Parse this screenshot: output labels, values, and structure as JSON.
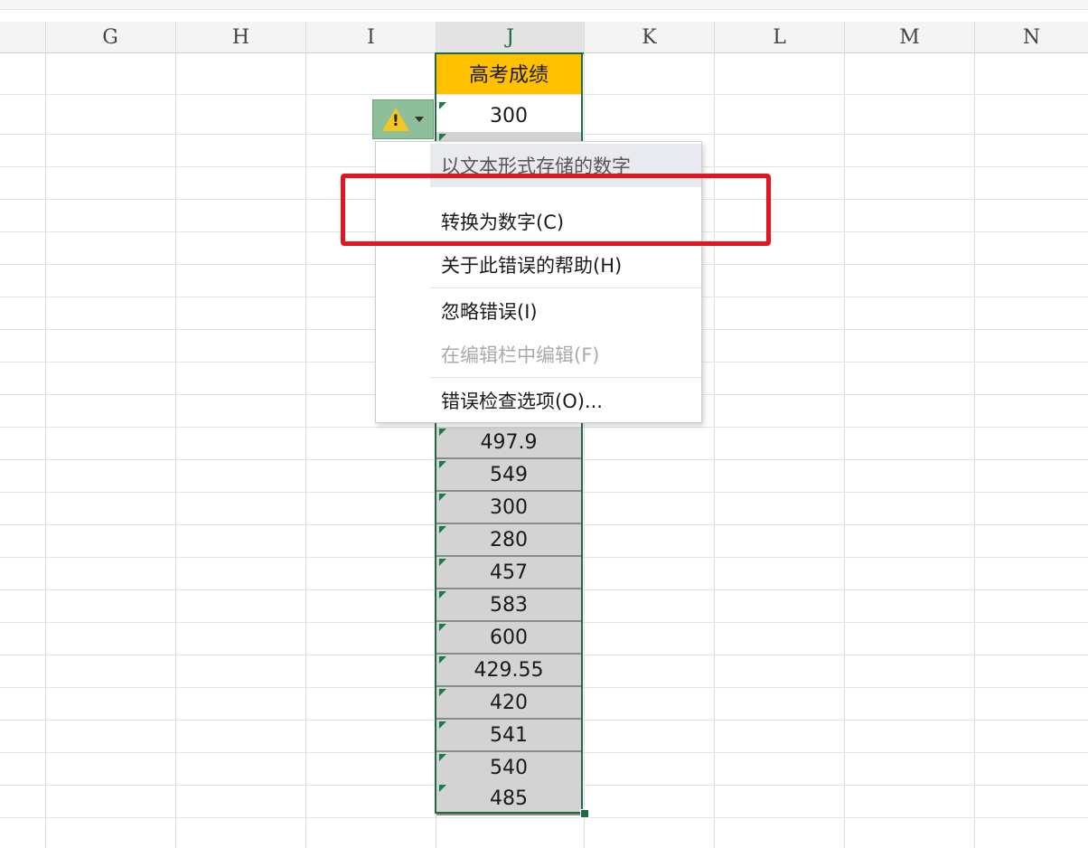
{
  "columns": [
    "G",
    "H",
    "I",
    "J",
    "K",
    "L",
    "M",
    "N"
  ],
  "active_column": "J",
  "header_cell": "高考成绩",
  "first_value": "300",
  "values": [
    "497.9",
    "549",
    "300",
    "280",
    "457",
    "583",
    "600",
    "429.55",
    "420",
    "541",
    "540",
    "485"
  ],
  "error_button": {
    "icon": "warning-icon",
    "caret": "chevron-down-icon"
  },
  "context_menu": {
    "title": "以文本形式存储的数字",
    "convert": "转换为数字(C)",
    "help": "关于此错误的帮助(H)",
    "ignore": "忽略错误(I)",
    "edit": "在编辑栏中编辑(F)",
    "options": "错误检查选项(O)..."
  },
  "colors": {
    "header_fill": "#ffc000",
    "highlight_box": "#e2161f",
    "selection": "#1e6b41"
  }
}
